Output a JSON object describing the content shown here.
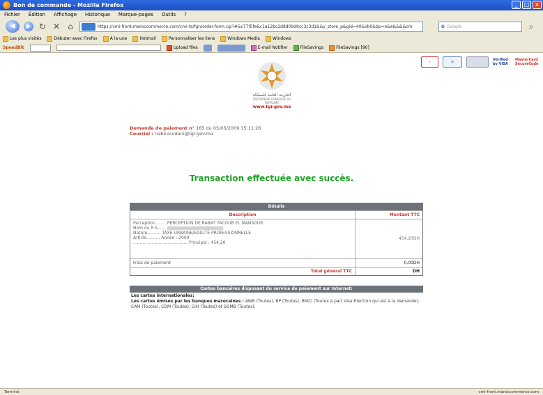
{
  "window": {
    "title": "Bon de commande - Mozilla Firefox"
  },
  "menu": [
    "Fichier",
    "Édition",
    "Affichage",
    "Historique",
    "Marque-pages",
    "Outils",
    "?"
  ],
  "nav": {
    "url": "https://cmi-front.maroccommerce.com/cmi-ts/fgn/order-form.cgi?#&c77f5fe&c1a12bc2d8d09d9cc3c3d1&&y_store_p&gid=40&cb0&bp=e&e&&&&cm",
    "search_placeholder": "Google"
  },
  "bookmarks": [
    "Les plus visités",
    "Débuter avec Firefox",
    "À la une",
    "Hotmail",
    "Personnaliser les liens",
    "Windows Media",
    "Windows"
  ],
  "toolbar": {
    "speedbit": "SpeedBit",
    "upload": "Upload files",
    "email": "E-mail Notifier",
    "file_savings": "FileSavings",
    "file_savings_count": "FileSavings [90]"
  },
  "logos": {
    "verified": "Verified by VISA",
    "mastercard": "MasterCard SecureCode"
  },
  "emblem": {
    "arabic": "الخزينة العامة للمملكة",
    "subtitle": "TRÉSORERIE GÉNÉRALE DU ROYAUME",
    "site": "www.tgr.gov.ma"
  },
  "commande": {
    "label": "Demande de paiement n°",
    "value": "165 du 05/05/2009 15:11:26",
    "courriel_label": "Courriel :",
    "courriel_value": "nabil.ourdani@tgr.gov.ma"
  },
  "success": "Transaction effectuée avec succès.",
  "details": {
    "header": "Détails",
    "col_description": "Description",
    "col_amount": "Montant TTC",
    "lines": [
      "Perception........ PERCEPTION DE RABAT YACOUB EL MANSOUR",
      "Nom ou R.S.....",
      "Nature.......... TAXE URBAINE/EDILITÉ PROFESSIONNELLE",
      "Article..........  Année : 2009",
      "......................................... Principal : 454,20"
    ],
    "amount": "454,20DH",
    "frais_label": "Frais de paiement",
    "frais_value": "0,00DH",
    "total_label": "Total général TTC",
    "total_value": "DH"
  },
  "cards": {
    "header": "Cartes bancaires disposant du service de paiement sur Internet:",
    "intl": "Les cartes internationales:",
    "local_label": "Les cartes émises par les banques marocaines :",
    "local_text": "AWB (Toutes), BP (Toutes), BMCI (Toutes à part Visa Electron qui est à la demande), CAM (Toutes), CDM (Toutes), CIH (Toutes) et SGMB (Toutes)."
  },
  "statusbar": {
    "left": "Terminé",
    "right": "cmi-front.maroccommerce.com"
  }
}
